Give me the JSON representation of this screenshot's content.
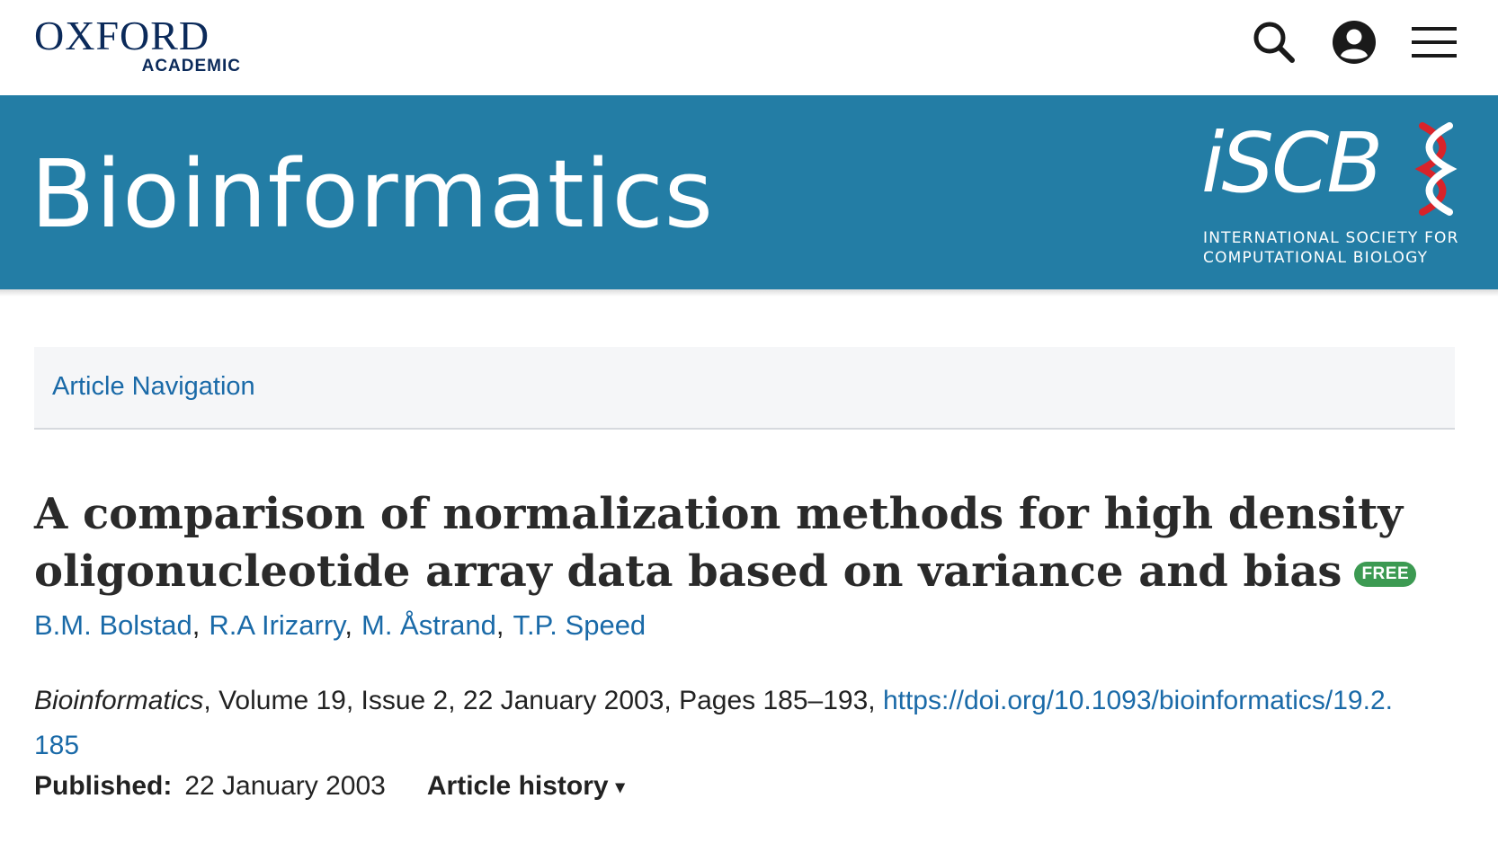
{
  "publisher": {
    "name": "OXFORD",
    "sub": "ACADEMIC"
  },
  "header_icons": [
    "search-icon",
    "account-icon",
    "menu-icon"
  ],
  "journal": {
    "title": "Bioinformatics"
  },
  "society": {
    "logo_text": "iSCB",
    "name_line1": "INTERNATIONAL SOCIETY FOR",
    "name_line2": "COMPUTATIONAL BIOLOGY"
  },
  "article_nav": {
    "label": "Article Navigation"
  },
  "article": {
    "title": "A comparison of normalization methods for high density oligonucleotide array data based on variance and bias",
    "badge": "FREE",
    "authors": [
      "B.M. Bolstad",
      "R.A Irizarry",
      "M. Åstrand",
      "T.P. Speed"
    ],
    "author_separator": ",",
    "citation": {
      "journal": "Bioinformatics",
      "details": ", Volume 19, Issue 2, 22 January 2003, Pages 185–193, ",
      "doi": "https://doi.org/10.1093/bioinformatics/19.2.185"
    },
    "published_label": "Published:",
    "published_date": "22 January 2003",
    "history_label": "Article history",
    "history_caret": "▾"
  },
  "colors": {
    "banner": "#237da5",
    "link": "#1a6aa8",
    "badge": "#3c9a52",
    "oxford_navy": "#0b2a5a"
  }
}
